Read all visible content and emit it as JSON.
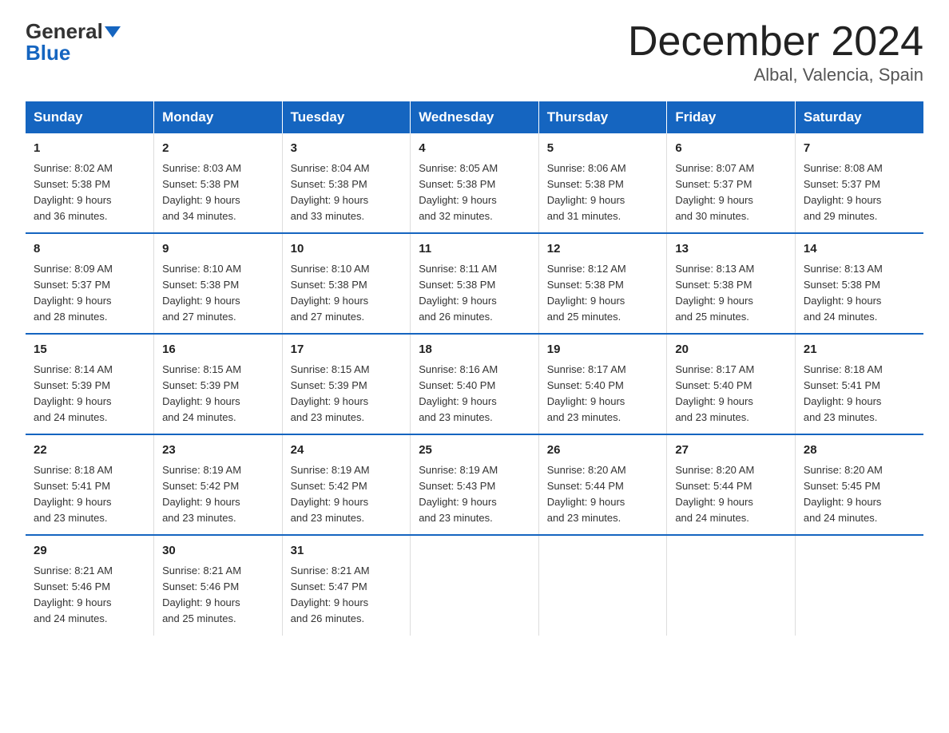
{
  "header": {
    "logo_line1": "General",
    "logo_line2": "Blue",
    "title": "December 2024",
    "subtitle": "Albal, Valencia, Spain"
  },
  "columns": [
    "Sunday",
    "Monday",
    "Tuesday",
    "Wednesday",
    "Thursday",
    "Friday",
    "Saturday"
  ],
  "weeks": [
    [
      {
        "day": "1",
        "info": "Sunrise: 8:02 AM\nSunset: 5:38 PM\nDaylight: 9 hours\nand 36 minutes."
      },
      {
        "day": "2",
        "info": "Sunrise: 8:03 AM\nSunset: 5:38 PM\nDaylight: 9 hours\nand 34 minutes."
      },
      {
        "day": "3",
        "info": "Sunrise: 8:04 AM\nSunset: 5:38 PM\nDaylight: 9 hours\nand 33 minutes."
      },
      {
        "day": "4",
        "info": "Sunrise: 8:05 AM\nSunset: 5:38 PM\nDaylight: 9 hours\nand 32 minutes."
      },
      {
        "day": "5",
        "info": "Sunrise: 8:06 AM\nSunset: 5:38 PM\nDaylight: 9 hours\nand 31 minutes."
      },
      {
        "day": "6",
        "info": "Sunrise: 8:07 AM\nSunset: 5:37 PM\nDaylight: 9 hours\nand 30 minutes."
      },
      {
        "day": "7",
        "info": "Sunrise: 8:08 AM\nSunset: 5:37 PM\nDaylight: 9 hours\nand 29 minutes."
      }
    ],
    [
      {
        "day": "8",
        "info": "Sunrise: 8:09 AM\nSunset: 5:37 PM\nDaylight: 9 hours\nand 28 minutes."
      },
      {
        "day": "9",
        "info": "Sunrise: 8:10 AM\nSunset: 5:38 PM\nDaylight: 9 hours\nand 27 minutes."
      },
      {
        "day": "10",
        "info": "Sunrise: 8:10 AM\nSunset: 5:38 PM\nDaylight: 9 hours\nand 27 minutes."
      },
      {
        "day": "11",
        "info": "Sunrise: 8:11 AM\nSunset: 5:38 PM\nDaylight: 9 hours\nand 26 minutes."
      },
      {
        "day": "12",
        "info": "Sunrise: 8:12 AM\nSunset: 5:38 PM\nDaylight: 9 hours\nand 25 minutes."
      },
      {
        "day": "13",
        "info": "Sunrise: 8:13 AM\nSunset: 5:38 PM\nDaylight: 9 hours\nand 25 minutes."
      },
      {
        "day": "14",
        "info": "Sunrise: 8:13 AM\nSunset: 5:38 PM\nDaylight: 9 hours\nand 24 minutes."
      }
    ],
    [
      {
        "day": "15",
        "info": "Sunrise: 8:14 AM\nSunset: 5:39 PM\nDaylight: 9 hours\nand 24 minutes."
      },
      {
        "day": "16",
        "info": "Sunrise: 8:15 AM\nSunset: 5:39 PM\nDaylight: 9 hours\nand 24 minutes."
      },
      {
        "day": "17",
        "info": "Sunrise: 8:15 AM\nSunset: 5:39 PM\nDaylight: 9 hours\nand 23 minutes."
      },
      {
        "day": "18",
        "info": "Sunrise: 8:16 AM\nSunset: 5:40 PM\nDaylight: 9 hours\nand 23 minutes."
      },
      {
        "day": "19",
        "info": "Sunrise: 8:17 AM\nSunset: 5:40 PM\nDaylight: 9 hours\nand 23 minutes."
      },
      {
        "day": "20",
        "info": "Sunrise: 8:17 AM\nSunset: 5:40 PM\nDaylight: 9 hours\nand 23 minutes."
      },
      {
        "day": "21",
        "info": "Sunrise: 8:18 AM\nSunset: 5:41 PM\nDaylight: 9 hours\nand 23 minutes."
      }
    ],
    [
      {
        "day": "22",
        "info": "Sunrise: 8:18 AM\nSunset: 5:41 PM\nDaylight: 9 hours\nand 23 minutes."
      },
      {
        "day": "23",
        "info": "Sunrise: 8:19 AM\nSunset: 5:42 PM\nDaylight: 9 hours\nand 23 minutes."
      },
      {
        "day": "24",
        "info": "Sunrise: 8:19 AM\nSunset: 5:42 PM\nDaylight: 9 hours\nand 23 minutes."
      },
      {
        "day": "25",
        "info": "Sunrise: 8:19 AM\nSunset: 5:43 PM\nDaylight: 9 hours\nand 23 minutes."
      },
      {
        "day": "26",
        "info": "Sunrise: 8:20 AM\nSunset: 5:44 PM\nDaylight: 9 hours\nand 23 minutes."
      },
      {
        "day": "27",
        "info": "Sunrise: 8:20 AM\nSunset: 5:44 PM\nDaylight: 9 hours\nand 24 minutes."
      },
      {
        "day": "28",
        "info": "Sunrise: 8:20 AM\nSunset: 5:45 PM\nDaylight: 9 hours\nand 24 minutes."
      }
    ],
    [
      {
        "day": "29",
        "info": "Sunrise: 8:21 AM\nSunset: 5:46 PM\nDaylight: 9 hours\nand 24 minutes."
      },
      {
        "day": "30",
        "info": "Sunrise: 8:21 AM\nSunset: 5:46 PM\nDaylight: 9 hours\nand 25 minutes."
      },
      {
        "day": "31",
        "info": "Sunrise: 8:21 AM\nSunset: 5:47 PM\nDaylight: 9 hours\nand 26 minutes."
      },
      {
        "day": "",
        "info": ""
      },
      {
        "day": "",
        "info": ""
      },
      {
        "day": "",
        "info": ""
      },
      {
        "day": "",
        "info": ""
      }
    ]
  ]
}
